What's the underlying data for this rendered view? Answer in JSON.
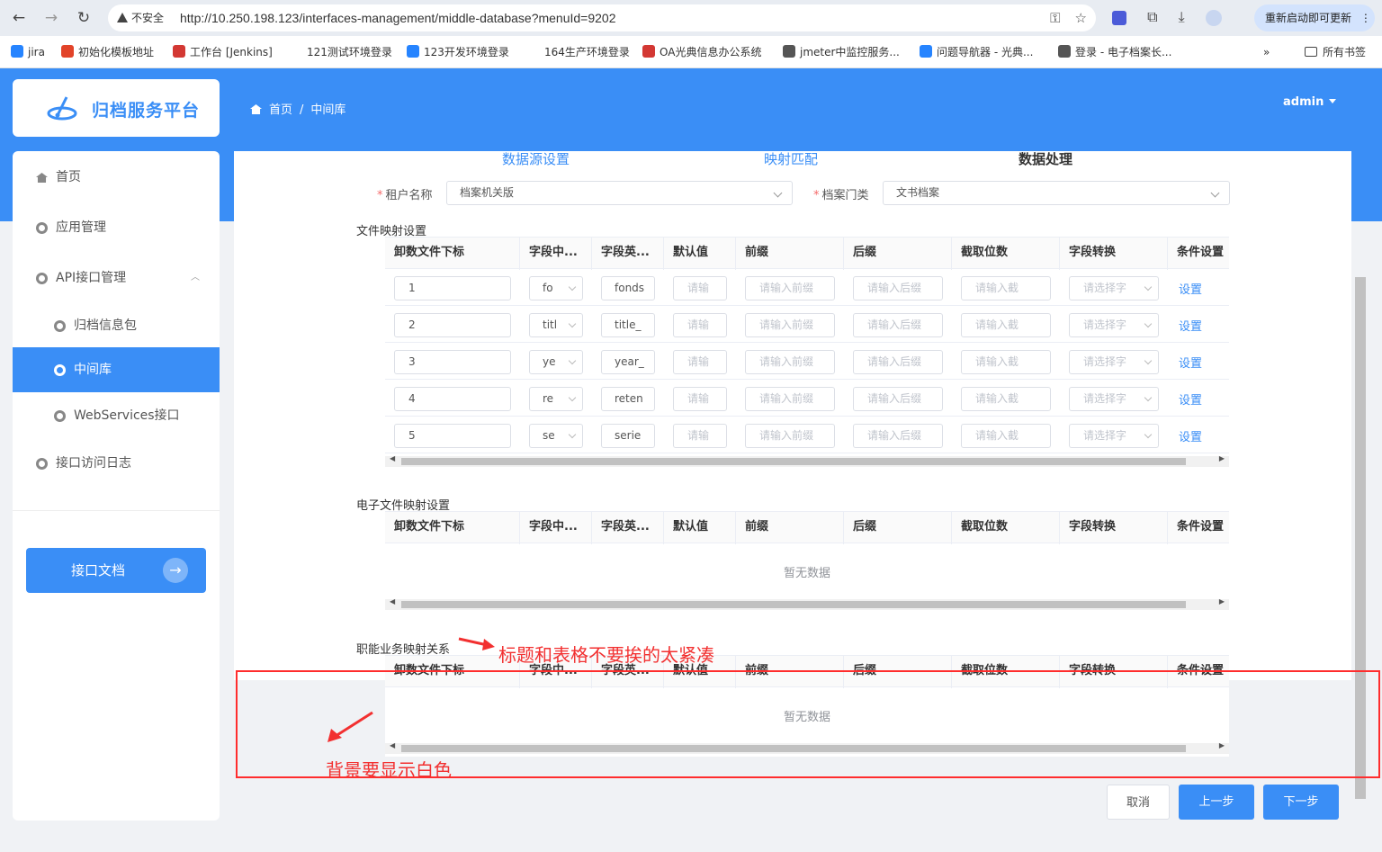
{
  "browser": {
    "insecure_label": "不安全",
    "url": "http://10.250.198.123/interfaces-management/middle-database?menuId=9202",
    "restart_label": "重新启动即可更新",
    "bookmarks": [
      {
        "label": "jira",
        "color": "#2684ff"
      },
      {
        "label": "初始化模板地址",
        "color": "#e24329"
      },
      {
        "label": "工作台 [Jenkins]",
        "color": "#d33833"
      },
      {
        "label": "121测试环境登录",
        "color": "#ffffff"
      },
      {
        "label": "123开发环境登录",
        "color": "#2684ff"
      },
      {
        "label": "164生产环境登录",
        "color": "#ffffff"
      },
      {
        "label": "OA光典信息办公系统",
        "color": "#d33833"
      },
      {
        "label": "jmeter中监控服务...",
        "color": "#555555"
      },
      {
        "label": "问题导航器 - 光典...",
        "color": "#2684ff"
      },
      {
        "label": "登录 - 电子档案长...",
        "color": "#555555"
      }
    ],
    "bookmarks_more": "»",
    "all_bookmarks": "所有书签"
  },
  "app": {
    "logo_text": "归档服务平台",
    "breadcrumb": [
      "首页",
      "中间库"
    ],
    "user": "admin"
  },
  "sidebar": {
    "items": [
      {
        "label": "首页",
        "icon": "home-icon"
      },
      {
        "label": "应用管理",
        "icon": "gear-icon"
      },
      {
        "label": "API接口管理",
        "icon": "gear-icon"
      },
      {
        "label": "归档信息包",
        "icon": "gear-icon"
      },
      {
        "label": "中间库",
        "icon": "gear-icon"
      },
      {
        "label": "WebServices接口",
        "icon": "gear-icon"
      },
      {
        "label": "接口访问日志",
        "icon": "gear-icon"
      }
    ],
    "doc_button": "接口文档"
  },
  "steps": [
    "数据源设置",
    "映射匹配",
    "数据处理"
  ],
  "form": {
    "tenant_label": "租户名称",
    "tenant_value": "档案机关版",
    "category_label": "档案门类",
    "category_value": "文书档案"
  },
  "columns": [
    "卸数文件下标",
    "字段中...",
    "字段英...",
    "默认值",
    "前缀",
    "后缀",
    "截取位数",
    "字段转换",
    "条件设置"
  ],
  "file_mapping": {
    "title": "文件映射设置",
    "rows": [
      {
        "index": "1",
        "cn": "fo",
        "en": "fonds"
      },
      {
        "index": "2",
        "cn": "titl",
        "en": "title_"
      },
      {
        "index": "3",
        "cn": "ye",
        "en": "year_"
      },
      {
        "index": "4",
        "cn": "re",
        "en": "reten"
      },
      {
        "index": "5",
        "cn": "se",
        "en": "serie"
      }
    ],
    "placeholders": {
      "default": "请输",
      "prefix": "请输入前缀",
      "suffix": "请输入后缀",
      "cut": "请输入截",
      "convert": "请选择字"
    },
    "set_link": "设置"
  },
  "efile_mapping": {
    "title": "电子文件映射设置",
    "empty": "暂无数据"
  },
  "business_mapping": {
    "title": "职能业务映射关系",
    "empty": "暂无数据"
  },
  "annotations": {
    "note1": "标题和表格不要挨的太紧凑",
    "note2": "背景要显示白色",
    "color": "#f23030"
  },
  "footer": {
    "cancel": "取消",
    "prev": "上一步",
    "next": "下一步"
  }
}
